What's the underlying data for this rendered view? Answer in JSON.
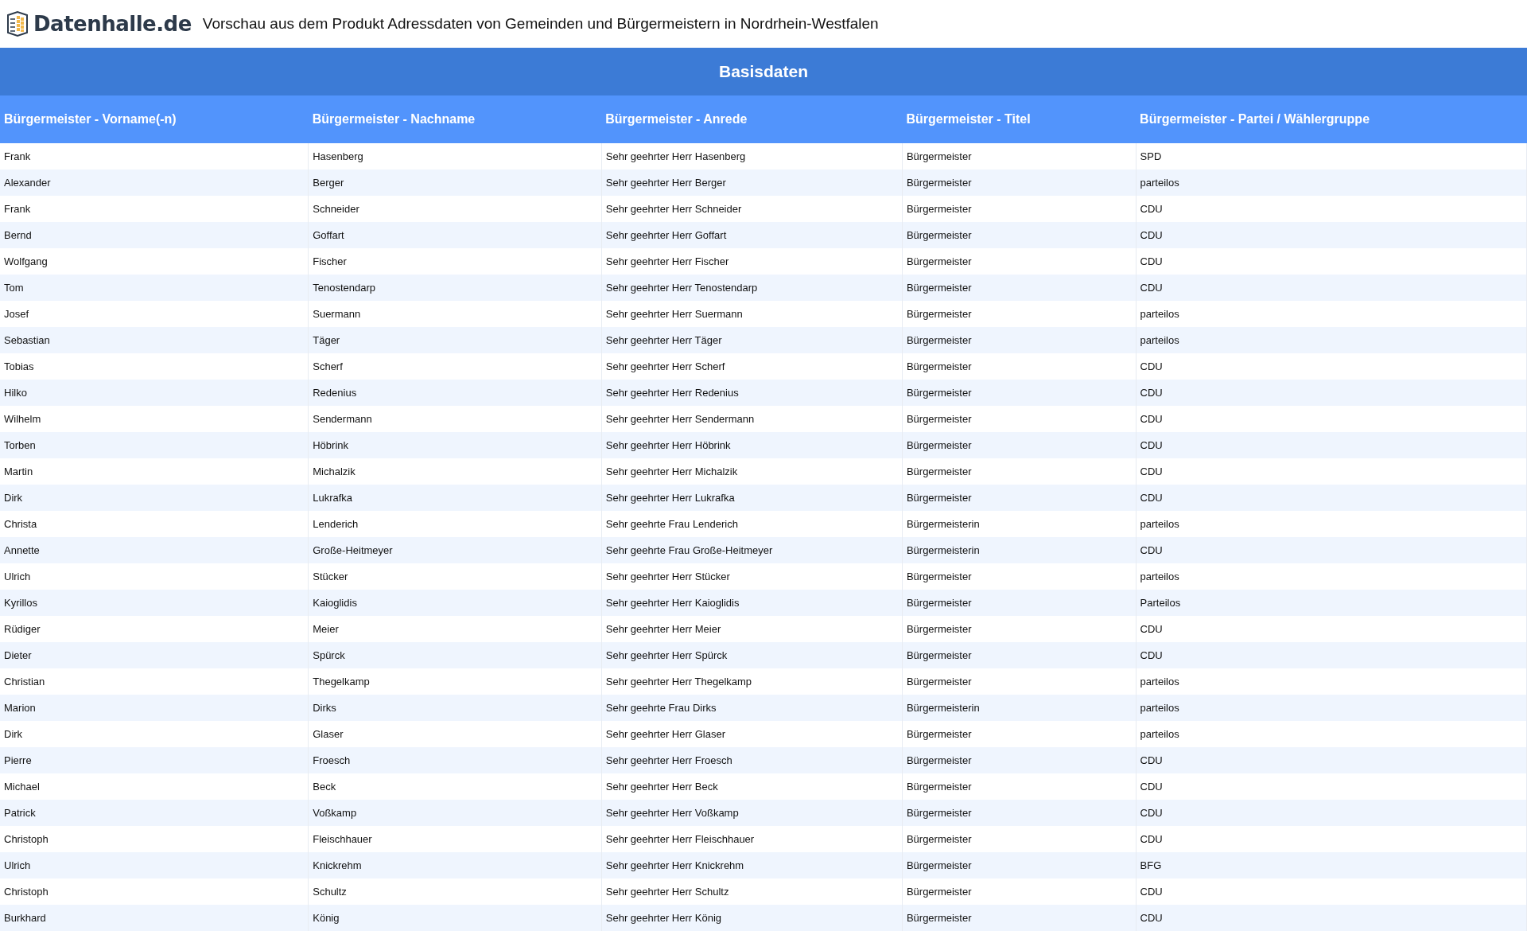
{
  "header": {
    "logo_text": "Datenhalle.de",
    "title": "Vorschau aus dem Produkt Adressdaten von Gemeinden und Bürgermeistern in Nordrhein-Westfalen"
  },
  "section_title": "Basisdaten",
  "table": {
    "columns": [
      "Bürgermeister - Vorname(-n)",
      "Bürgermeister - Nachname",
      "Bürgermeister - Anrede",
      "Bürgermeister - Titel",
      "Bürgermeister - Partei / Wählergruppe"
    ],
    "rows": [
      [
        "Frank",
        "Hasenberg",
        "Sehr geehrter Herr Hasenberg",
        "Bürgermeister",
        "SPD"
      ],
      [
        "Alexander",
        "Berger",
        "Sehr geehrter Herr Berger",
        "Bürgermeister",
        "parteilos"
      ],
      [
        "Frank",
        "Schneider",
        "Sehr geehrter Herr Schneider",
        "Bürgermeister",
        "CDU"
      ],
      [
        "Bernd",
        "Goffart",
        "Sehr geehrter Herr Goffart",
        "Bürgermeister",
        "CDU"
      ],
      [
        "Wolfgang",
        "Fischer",
        "Sehr geehrter Herr Fischer",
        "Bürgermeister",
        "CDU"
      ],
      [
        "Tom",
        "Tenostendarp",
        "Sehr geehrter Herr Tenostendarp",
        "Bürgermeister",
        "CDU"
      ],
      [
        "Josef",
        "Suermann",
        "Sehr geehrter Herr Suermann",
        "Bürgermeister",
        "parteilos"
      ],
      [
        "Sebastian",
        "Täger",
        "Sehr geehrter Herr Täger",
        "Bürgermeister",
        "parteilos"
      ],
      [
        "Tobias",
        "Scherf",
        "Sehr geehrter Herr Scherf",
        "Bürgermeister",
        "CDU"
      ],
      [
        "Hilko",
        "Redenius",
        "Sehr geehrter Herr Redenius",
        "Bürgermeister",
        "CDU"
      ],
      [
        "Wilhelm",
        "Sendermann",
        "Sehr geehrter Herr Sendermann",
        "Bürgermeister",
        "CDU"
      ],
      [
        "Torben",
        "Höbrink",
        "Sehr geehrter Herr Höbrink",
        "Bürgermeister",
        "CDU"
      ],
      [
        "Martin",
        "Michalzik",
        "Sehr geehrter Herr Michalzik",
        "Bürgermeister",
        "CDU"
      ],
      [
        "Dirk",
        "Lukrafka",
        "Sehr geehrter Herr Lukrafka",
        "Bürgermeister",
        "CDU"
      ],
      [
        "Christa",
        "Lenderich",
        "Sehr geehrte Frau Lenderich",
        "Bürgermeisterin",
        "parteilos"
      ],
      [
        "Annette",
        "Große-Heitmeyer",
        "Sehr geehrte Frau Große-Heitmeyer",
        "Bürgermeisterin",
        "CDU"
      ],
      [
        "Ulrich",
        "Stücker",
        "Sehr geehrter Herr Stücker",
        "Bürgermeister",
        "parteilos"
      ],
      [
        "Kyrillos",
        "Kaioglidis",
        "Sehr geehrter Herr Kaioglidis",
        "Bürgermeister",
        "Parteilos"
      ],
      [
        "Rüdiger",
        "Meier",
        "Sehr geehrter Herr Meier",
        "Bürgermeister",
        "CDU"
      ],
      [
        "Dieter",
        "Spürck",
        "Sehr geehrter Herr Spürck",
        "Bürgermeister",
        "CDU"
      ],
      [
        "Christian",
        "Thegelkamp",
        "Sehr geehrter Herr Thegelkamp",
        "Bürgermeister",
        "parteilos"
      ],
      [
        "Marion",
        "Dirks",
        "Sehr geehrte Frau Dirks",
        "Bürgermeisterin",
        "parteilos"
      ],
      [
        "Dirk",
        "Glaser",
        "Sehr geehrter Herr Glaser",
        "Bürgermeister",
        "parteilos"
      ],
      [
        "Pierre",
        "Froesch",
        "Sehr geehrter Herr Froesch",
        "Bürgermeister",
        "CDU"
      ],
      [
        "Michael",
        "Beck",
        "Sehr geehrter Herr Beck",
        "Bürgermeister",
        "CDU"
      ],
      [
        "Patrick",
        "Voßkamp",
        "Sehr geehrter Herr Voßkamp",
        "Bürgermeister",
        "CDU"
      ],
      [
        "Christoph",
        "Fleischhauer",
        "Sehr geehrter Herr Fleischhauer",
        "Bürgermeister",
        "CDU"
      ],
      [
        "Ulrich",
        "Knickrehm",
        "Sehr geehrter Herr Knickrehm",
        "Bürgermeister",
        "BFG"
      ],
      [
        "Christoph",
        "Schultz",
        "Sehr geehrter Herr Schultz",
        "Bürgermeister",
        "CDU"
      ],
      [
        "Burkhard",
        "König",
        "Sehr geehrter Herr König",
        "Bürgermeister",
        "CDU"
      ]
    ]
  }
}
